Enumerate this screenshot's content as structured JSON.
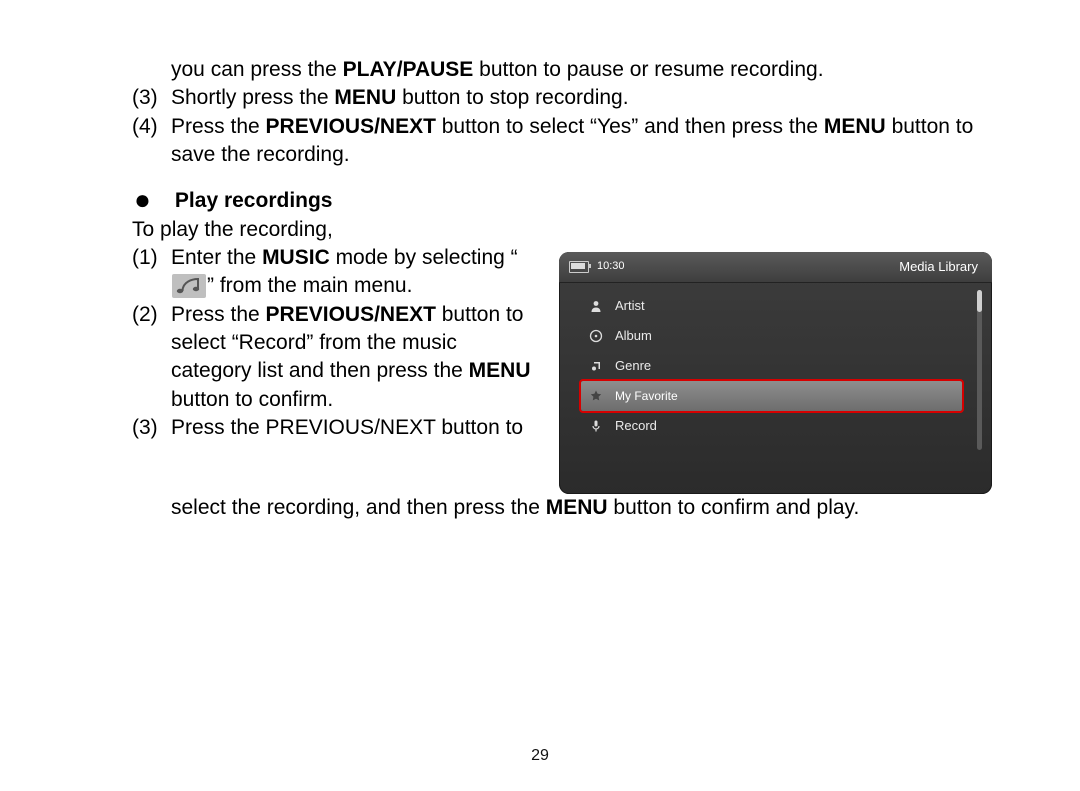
{
  "page_number": "29",
  "top": {
    "line1_pre": "you can press the ",
    "line1_bold": "PLAY/PAUSE",
    "line1_post": " button to pause or resume recording.",
    "item3_num": "(3)",
    "item3_pre": "Shortly press the ",
    "item3_bold": "MENU",
    "item3_post": " button to stop recording.",
    "item4_num": "(4)",
    "item4_pre": "Press the ",
    "item4_bold1": "PREVIOUS/NEXT",
    "item4_mid": " button to select “Yes” and then press the ",
    "item4_bold2": "MENU",
    "item4_post": " button to save the recording."
  },
  "section": {
    "title": "Play recordings",
    "intro": "To play the recording,",
    "s1_num": "(1)",
    "s1_pre": "Enter the ",
    "s1_bold": "MUSIC",
    "s1_mid": " mode by selecting “",
    "s1_post": "” from the main menu.",
    "s2_num": "(2)",
    "s2_pre": "Press the ",
    "s2_bold1": "PREVIOUS/NEXT",
    "s2_mid": " button to select “Record” from the music category list and then press the ",
    "s2_bold2": "MENU",
    "s2_post": " button to confirm.",
    "s3_num": "(3)",
    "s3_pre": "Press the PREVIOUS/NEXT button to select the recording, and then press the ",
    "s3_bold": "MENU",
    "s3_post": " button to confirm and play."
  },
  "device": {
    "time": "10:30",
    "title": "Media Library",
    "items": [
      {
        "label": "Artist",
        "icon": "person-icon",
        "highlight": false
      },
      {
        "label": "Album",
        "icon": "disc-icon",
        "highlight": false
      },
      {
        "label": "Genre",
        "icon": "notes-icon",
        "highlight": false
      },
      {
        "label": "My Favorite",
        "icon": "star-icon",
        "highlight": true
      },
      {
        "label": "Record",
        "icon": "mic-icon",
        "highlight": false
      }
    ]
  },
  "icons": {
    "music_inline": "music-icon"
  }
}
